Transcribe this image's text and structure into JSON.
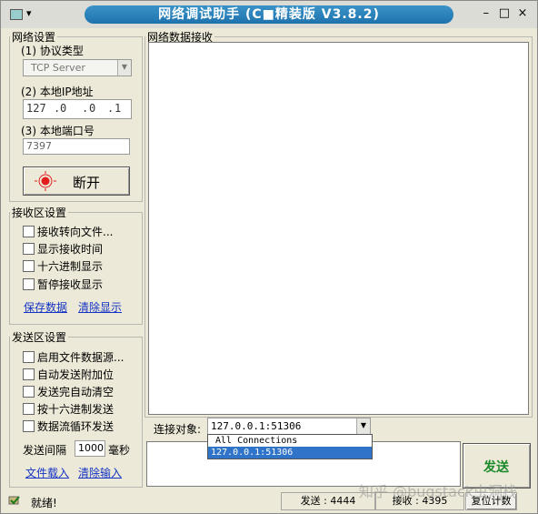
{
  "window": {
    "title": "网络调试助手 (C■精装版 V3.8.2)",
    "min": "–",
    "max": "□",
    "close": "×",
    "sysmenu_arrow": "▾"
  },
  "net": {
    "group": "网络设置",
    "protocol_label": "(1) 协议类型",
    "protocol_value": "TCP Server",
    "ip_label": "(2) 本地IP地址",
    "ip": [
      "127",
      "0",
      "0",
      "1"
    ],
    "port_label": "(3) 本地端口号",
    "port": "7397",
    "toggle_button": "断开"
  },
  "recv": {
    "group": "接收区设置",
    "options": [
      "接收转向文件...",
      "显示接收时间",
      "十六进制显示",
      "暂停接收显示"
    ],
    "save_link": "保存数据",
    "clear_link": "清除显示"
  },
  "send": {
    "group": "发送区设置",
    "options": [
      "启用文件数据源...",
      "自动发送附加位",
      "发送完自动清空",
      "按十六进制发送",
      "数据流循环发送"
    ],
    "interval_label": "发送间隔",
    "interval_value": "1000",
    "interval_unit": "毫秒",
    "load_link": "文件载入",
    "clear_link": "清除输入"
  },
  "recv_pane": {
    "title": "网络数据接收"
  },
  "connection": {
    "label": "连接对象:",
    "selected": "127.0.0.1:51306",
    "options": [
      "All Connections",
      "127.0.0.1:51306"
    ]
  },
  "send_button": "发送",
  "status": {
    "ready": "就绪!",
    "sent_label": "发送 :",
    "sent": "4444",
    "recv_label": "接收 :",
    "recv": "4395",
    "reset": "复位计数"
  },
  "watermark": "知乎 @bugstack虫洞栈",
  "colors": {
    "title_bar": "#1f73ad",
    "link": "#1433c4",
    "send_text": "#1b8a2a",
    "selected": "#2f74c8",
    "record": "#e11d1d"
  }
}
